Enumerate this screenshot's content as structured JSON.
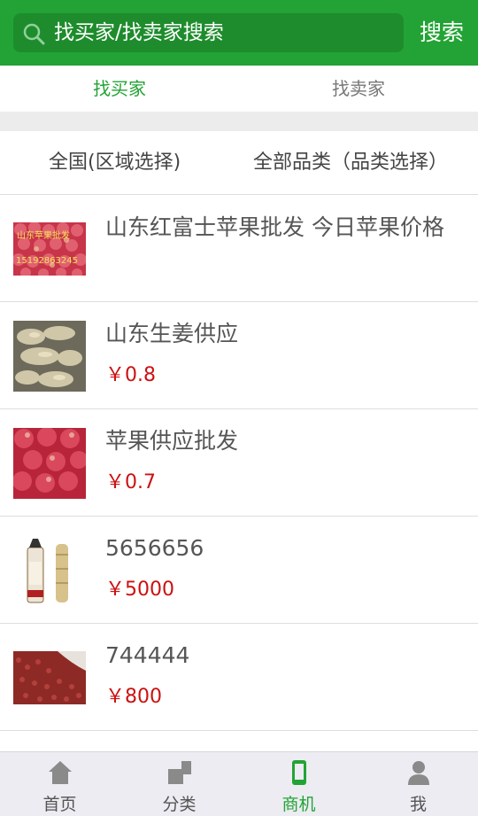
{
  "header": {
    "search_text": "找买家/找卖家搜索",
    "search_button": "搜索"
  },
  "tabs": [
    {
      "label": "找买家",
      "active": true
    },
    {
      "label": "找卖家",
      "active": false
    }
  ],
  "filters": {
    "region": "全国(区域选择)",
    "category": "全部品类（品类选择）"
  },
  "listings": [
    {
      "title": "山东红富士苹果批发 今日苹果价格",
      "price": "",
      "thumb_text": [
        "山东苹果批发",
        "15192863245"
      ]
    },
    {
      "title": "山东生姜供应",
      "price": "￥0.8",
      "thumb_text": []
    },
    {
      "title": "苹果供应批发",
      "price": "￥0.7",
      "thumb_text": []
    },
    {
      "title": "5656656",
      "price": "￥5000",
      "thumb_text": []
    },
    {
      "title": "744444",
      "price": "￥800",
      "thumb_text": []
    }
  ],
  "bottom_nav": [
    {
      "label": "首页",
      "icon": "home-icon",
      "active": false
    },
    {
      "label": "分类",
      "icon": "category-icon",
      "active": false
    },
    {
      "label": "商机",
      "icon": "phone-icon",
      "active": true
    },
    {
      "label": "我",
      "icon": "user-icon",
      "active": false
    }
  ],
  "colors": {
    "brand_green": "#23a335",
    "search_box": "#1e8c2c",
    "price_red": "#cc1111"
  }
}
